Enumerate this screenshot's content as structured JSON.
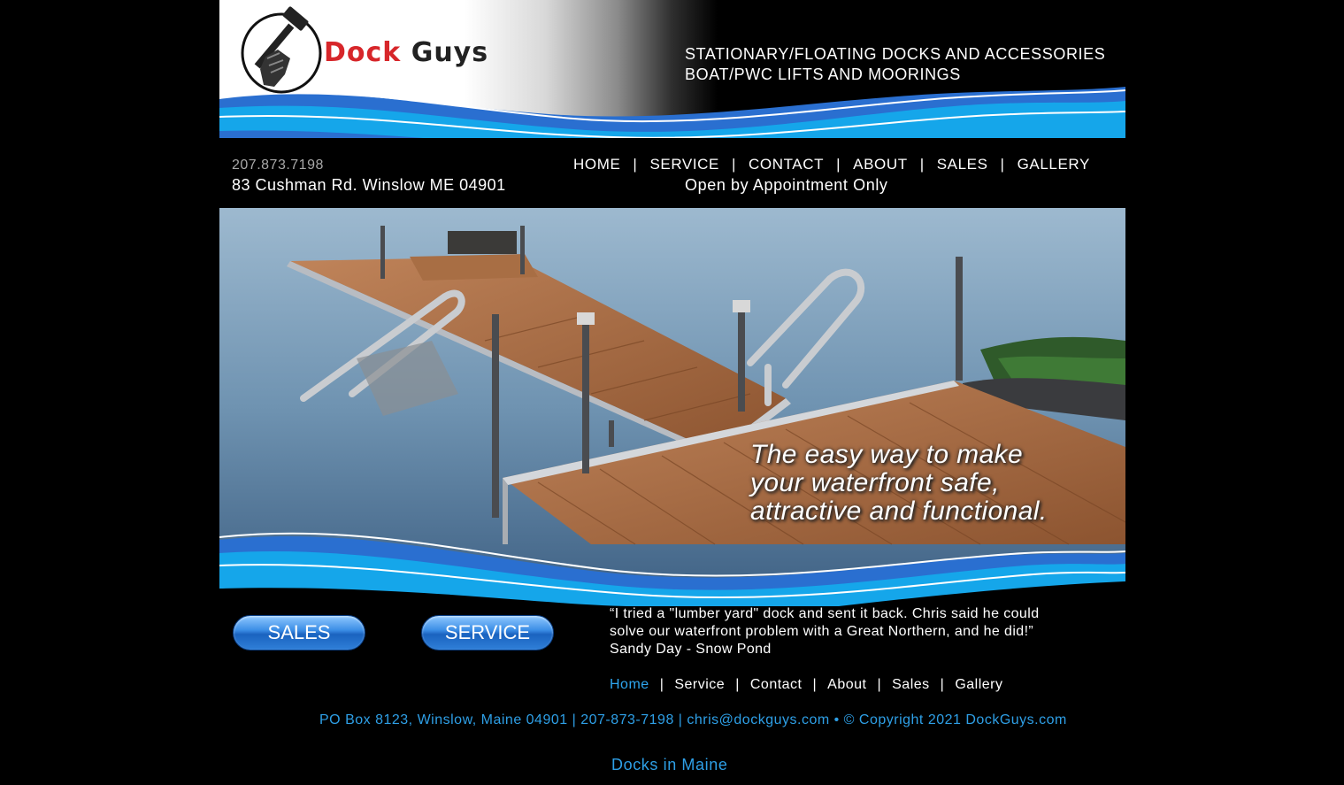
{
  "header": {
    "logo_word_1": "Dock",
    "logo_word_2": "Guys",
    "tagline": "Stationary/Floating Docks and Accessories Boat/PWC Lifts and Moorings"
  },
  "info": {
    "phone": "207.873.7198",
    "address": "83 Cushman Rd. Winslow ME 04901",
    "hours": "Open by Appointment Only"
  },
  "main_nav": {
    "items": [
      "HOME",
      "SERVICE",
      "CONTACT",
      "ABOUT",
      "SALES",
      "GALLERY"
    ],
    "separator": "|"
  },
  "hero": {
    "caption_line_1": "The easy way to make",
    "caption_line_2": "your waterfront safe,",
    "caption_line_3": "attractive and functional."
  },
  "buttons": {
    "sales": "SALES",
    "service": "SERVICE"
  },
  "testimonial": {
    "quote_line_1": "“I tried a \"lumber yard\" dock and sent it back. Chris said he could",
    "quote_line_2": "solve our waterfront problem with a Great Northern, and he did!”",
    "author": "Sandy Day - Snow Pond"
  },
  "footer_nav": {
    "items": [
      "Home",
      "Service",
      "Contact",
      "About",
      "Sales",
      "Gallery"
    ],
    "separator": "|",
    "active": "Home"
  },
  "footer": {
    "contact_line": "PO Box 8123, Winslow, Maine 04901 | 207-873-7198 | chris@dockguys.com • © Copyright 2021 DockGuys.com",
    "link": "Docks in Maine"
  },
  "colors": {
    "accent_blue": "#2e9fe6",
    "logo_red": "#d7262a",
    "wave_light": "#1aa8ec",
    "wave_dark": "#2a6fd0"
  }
}
